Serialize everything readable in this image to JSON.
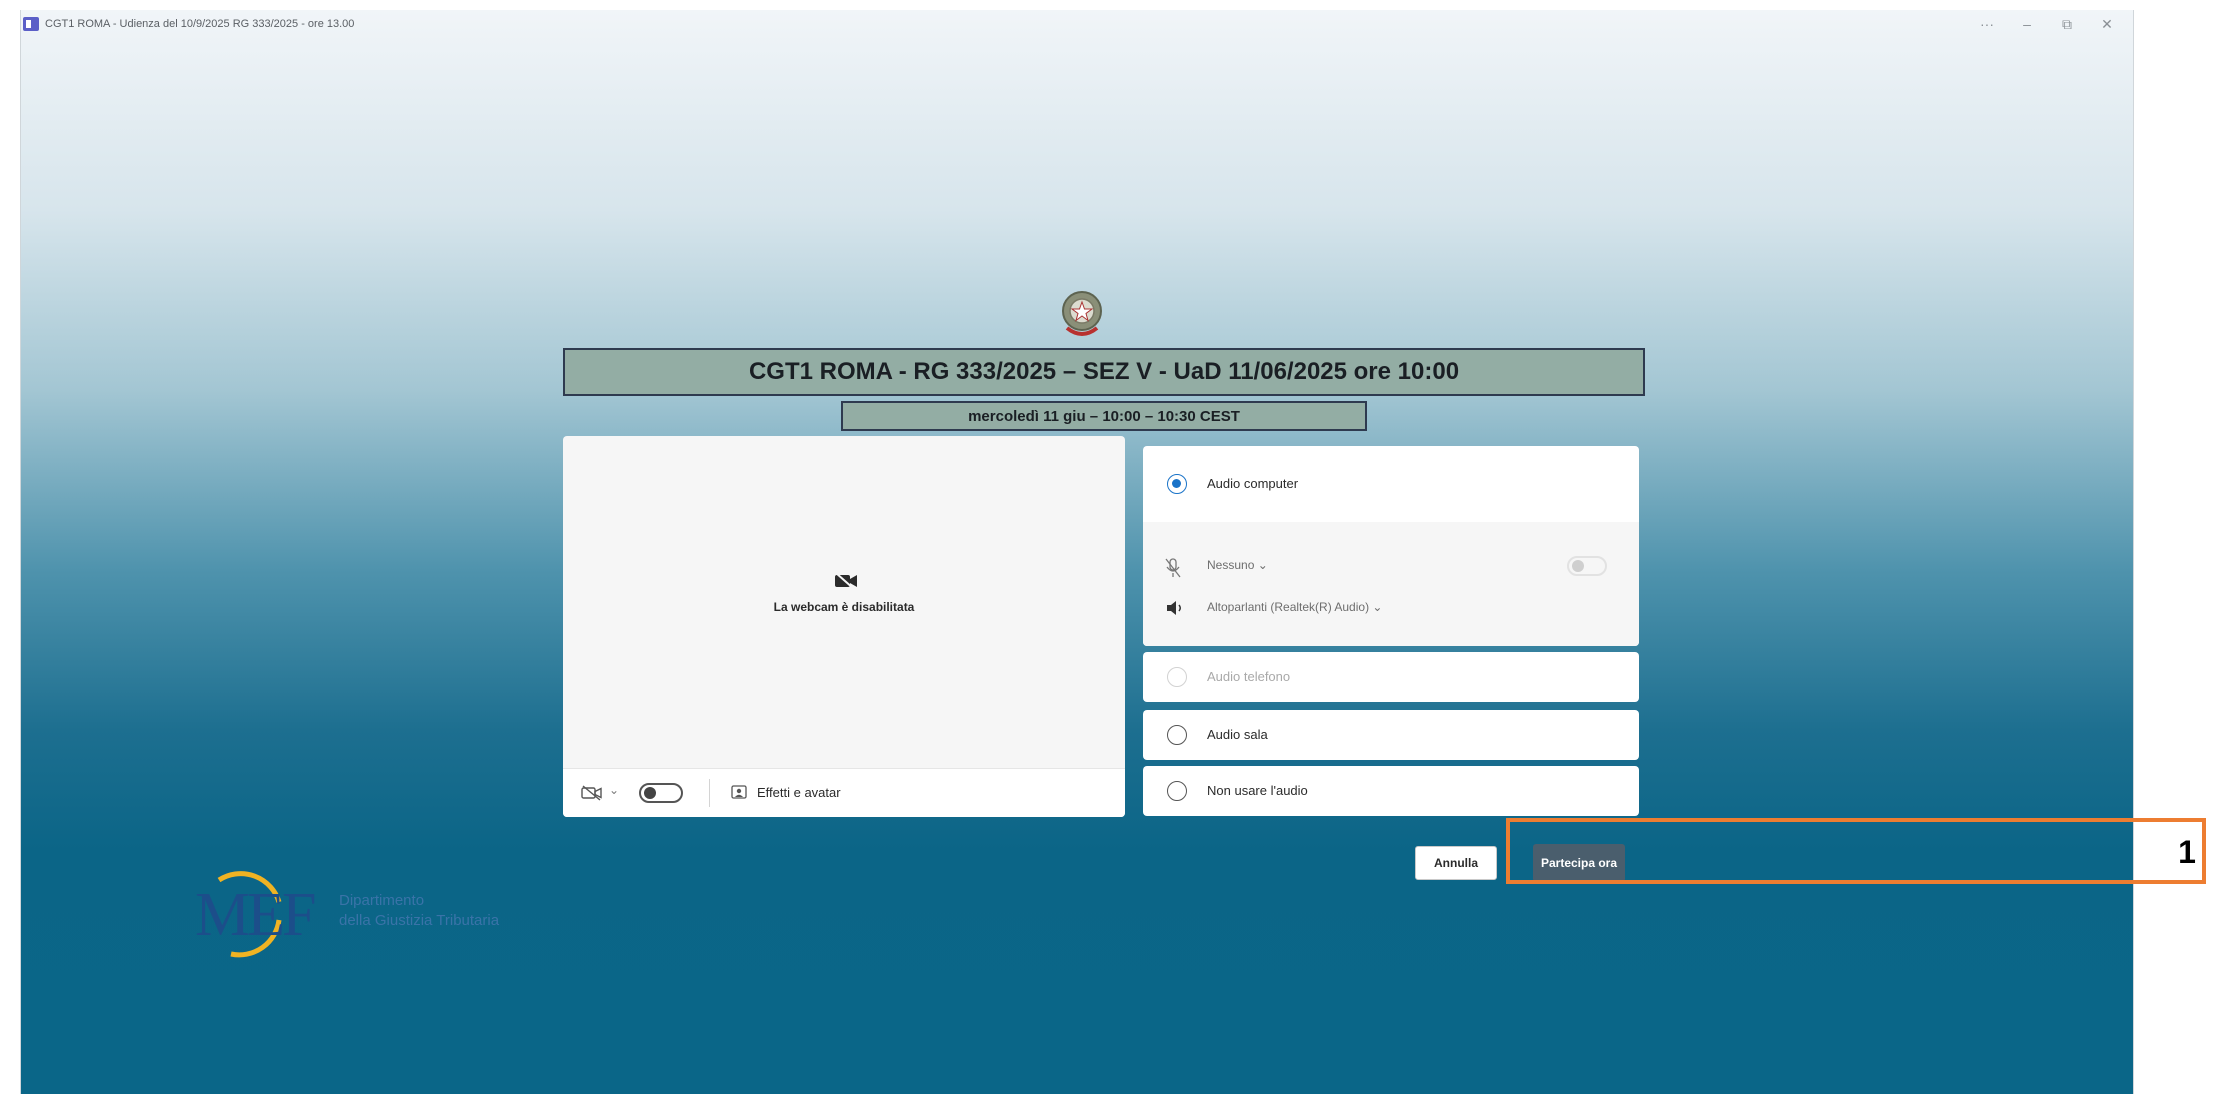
{
  "window": {
    "title": "CGT1 ROMA - Udienza del 10/9/2025 RG 333/2025 - ore 13.00",
    "controls": {
      "more": "···",
      "minimize": "–",
      "restore": "⧉",
      "close": "✕"
    }
  },
  "meeting": {
    "title": "CGT1 ROMA - RG 333/2025 – SEZ V - UaD 11/06/2025 ore 10:00",
    "schedule": "mercoledì 11 giu – 10:00 – 10:30 CEST"
  },
  "video": {
    "disabled_text": "La webcam è disabilitata",
    "camera_on": false,
    "effects_label": "Effetti e avatar"
  },
  "audio": {
    "options": [
      {
        "label": "Audio computer",
        "selected": true,
        "enabled": true
      },
      {
        "label": "Audio telefono",
        "selected": false,
        "enabled": false
      },
      {
        "label": "Audio sala",
        "selected": false,
        "enabled": true
      },
      {
        "label": "Non usare l'audio",
        "selected": false,
        "enabled": true
      }
    ],
    "microphone": "Nessuno ⌄",
    "microphone_on": false,
    "speaker": "Altoparlanti (Realtek(R) Audio) ⌄"
  },
  "actions": {
    "cancel_label": "Annulla",
    "join_label": "Partecipa ora"
  },
  "callout": {
    "number": "1",
    "color": "#ed7d31"
  },
  "footer_logo": {
    "letters": "MEF",
    "line1": "Dipartimento",
    "line2": "della Giustizia Tributaria"
  },
  "colors": {
    "accent": "#1a73c8",
    "banner_bg": "#93ada4",
    "join_button": "#4a5e6d",
    "background_bottom": "#0a6688"
  }
}
